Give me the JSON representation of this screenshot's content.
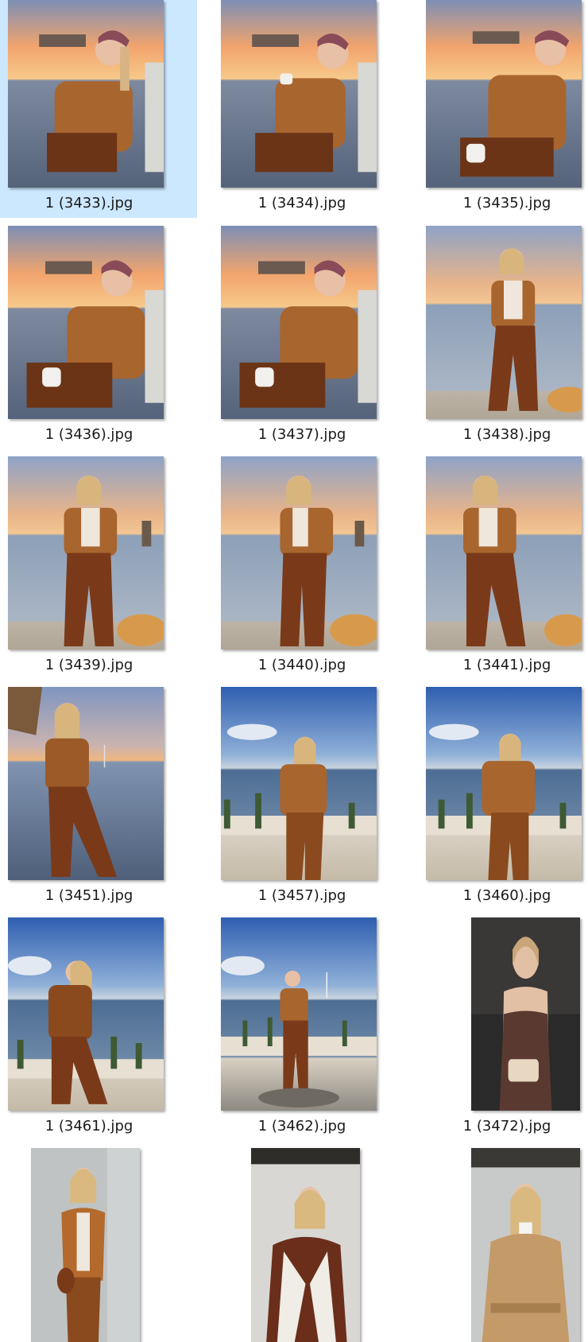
{
  "files": [
    {
      "name": "1 (3433).jpg",
      "scene": "sunset-seated",
      "selected": true
    },
    {
      "name": "1 (3434).jpg",
      "scene": "sunset-seated",
      "selected": false
    },
    {
      "name": "1 (3435).jpg",
      "scene": "sunset-seated",
      "selected": false
    },
    {
      "name": "1 (3436).jpg",
      "scene": "sunset-seated",
      "selected": false
    },
    {
      "name": "1 (3437).jpg",
      "scene": "sunset-seated",
      "selected": false
    },
    {
      "name": "1 (3438).jpg",
      "scene": "sunset-standing",
      "selected": false
    },
    {
      "name": "1 (3439).jpg",
      "scene": "sunset-standing",
      "selected": false
    },
    {
      "name": "1 (3440).jpg",
      "scene": "sunset-standing",
      "selected": false
    },
    {
      "name": "1 (3441).jpg",
      "scene": "sunset-standing",
      "selected": false
    },
    {
      "name": "1 (3451).jpg",
      "scene": "sunset-walking",
      "selected": false
    },
    {
      "name": "1 (3457).jpg",
      "scene": "blue-sky-terrace",
      "selected": false
    },
    {
      "name": "1 (3460).jpg",
      "scene": "blue-sky-terrace",
      "selected": false
    },
    {
      "name": "1 (3461).jpg",
      "scene": "blue-sky-terrace",
      "selected": false
    },
    {
      "name": "1 (3462).jpg",
      "scene": "blue-sky-terrace",
      "selected": false
    },
    {
      "name": "1 (3472).jpg",
      "scene": "dark-portrait",
      "selected": false
    },
    {
      "name": "",
      "scene": "indoor-suede",
      "selected": false
    },
    {
      "name": "",
      "scene": "indoor-knit",
      "selected": false
    },
    {
      "name": "",
      "scene": "indoor-trench",
      "selected": false
    }
  ],
  "colors": {
    "selection": "#cce8ff",
    "label": "#1a1a1a"
  }
}
